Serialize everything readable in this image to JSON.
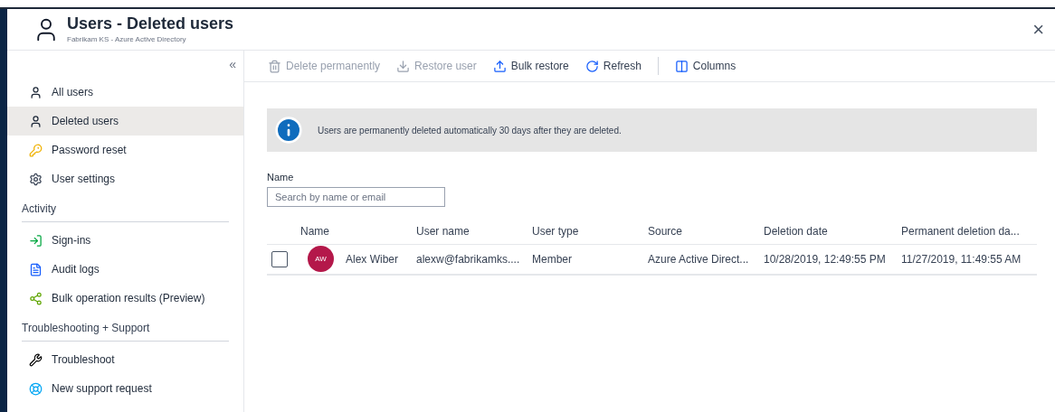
{
  "header": {
    "title": "Users - Deleted users",
    "subtitle": "Fabrikam KS - Azure Active Directory",
    "close": "×"
  },
  "collapse": "«",
  "sidebar": {
    "sections": [
      {
        "items": [
          {
            "label": "All users",
            "selected": false
          },
          {
            "label": "Deleted users",
            "selected": true
          },
          {
            "label": "Password reset",
            "selected": false
          },
          {
            "label": "User settings",
            "selected": false
          }
        ]
      },
      {
        "heading": "Activity",
        "items": [
          {
            "label": "Sign-ins",
            "selected": false
          },
          {
            "label": "Audit logs",
            "selected": false
          },
          {
            "label": "Bulk operation results (Preview)",
            "selected": false
          }
        ]
      },
      {
        "heading": "Troubleshooting + Support",
        "items": [
          {
            "label": "Troubleshoot",
            "selected": false
          },
          {
            "label": "New support request",
            "selected": false
          }
        ]
      }
    ]
  },
  "toolbar": [
    {
      "label": "Delete permanently",
      "disabled": true
    },
    {
      "label": "Restore user",
      "disabled": true
    },
    {
      "label": "Bulk restore",
      "disabled": false
    },
    {
      "label": "Refresh",
      "disabled": false
    },
    {
      "label": "Columns",
      "disabled": false
    }
  ],
  "info": {
    "text": "Users are permanently deleted automatically 30 days after they are deleted."
  },
  "filter": {
    "label": "Name",
    "placeholder": "Search by name or email"
  },
  "table": {
    "columns": [
      "Name",
      "User name",
      "User type",
      "Source",
      "Deletion date",
      "Permanent deletion da..."
    ],
    "rows": [
      {
        "checked": false,
        "initials": "AW",
        "color": "#b4184a",
        "cells": [
          "Alex Wiber",
          "alexw@fabrikamks....",
          "Member",
          "Azure Active Direct...",
          "10/28/2019, 12:49:55 PM",
          "11/27/2019, 11:49:55 AM"
        ]
      }
    ]
  }
}
